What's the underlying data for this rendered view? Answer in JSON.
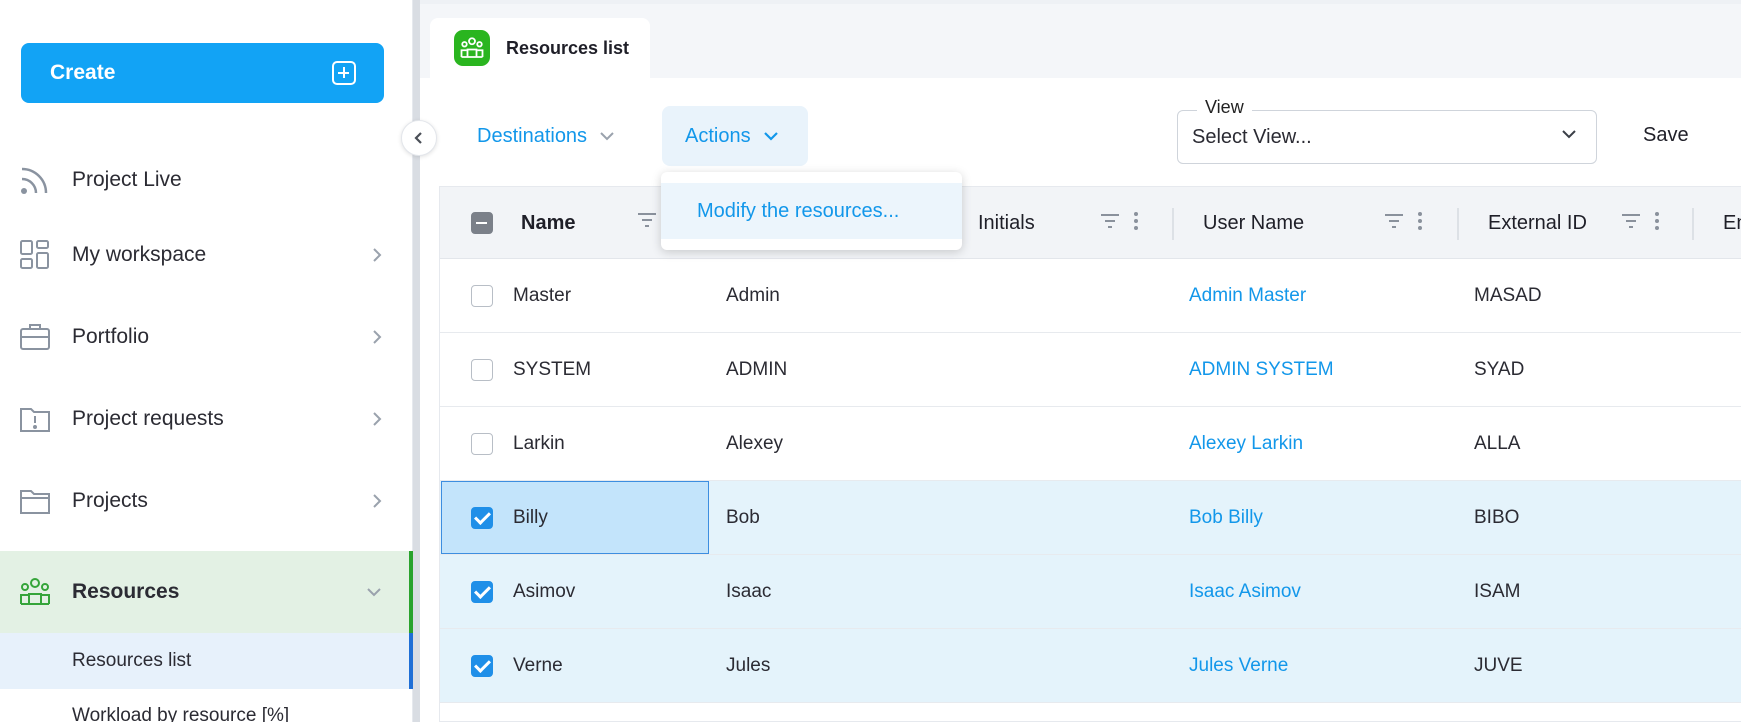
{
  "sidebar": {
    "create_label": "Create",
    "items": [
      {
        "label": "Project Live"
      },
      {
        "label": "My workspace"
      },
      {
        "label": "Portfolio"
      },
      {
        "label": "Project requests"
      },
      {
        "label": "Projects"
      },
      {
        "label": "Resources"
      }
    ],
    "sub_items": [
      {
        "label": "Resources list"
      },
      {
        "label": "Workload by resource [%]"
      }
    ]
  },
  "tab": {
    "label": "Resources list"
  },
  "toolbar": {
    "destinations_label": "Destinations",
    "actions_label": "Actions",
    "view_legend": "View",
    "view_value": "Select View...",
    "save_label": "Save"
  },
  "actions_menu": {
    "items": [
      {
        "label": "Modify the resources..."
      }
    ]
  },
  "table": {
    "headers": [
      "Name",
      "Initials",
      "User Name",
      "External ID",
      "En"
    ],
    "rows": [
      {
        "name": "Master",
        "first": "Admin",
        "user": "Admin Master",
        "ext": "MASAD",
        "checked": false
      },
      {
        "name": "SYSTEM",
        "first": "ADMIN",
        "user": "ADMIN SYSTEM",
        "ext": "SYAD",
        "checked": false
      },
      {
        "name": "Larkin",
        "first": "Alexey",
        "user": "Alexey Larkin",
        "ext": "ALLA",
        "checked": false
      },
      {
        "name": "Billy",
        "first": "Bob",
        "user": "Bob Billy",
        "ext": "BIBO",
        "checked": true
      },
      {
        "name": "Asimov",
        "first": "Isaac",
        "user": "Isaac Asimov",
        "ext": "ISAM",
        "checked": true
      },
      {
        "name": "Verne",
        "first": "Jules",
        "user": "Jules Verne",
        "ext": "JUVE",
        "checked": true
      }
    ]
  },
  "colors": {
    "accent": "#12a3f5",
    "link": "#1297ea",
    "active_nav": "#e3f1e4",
    "selected_row": "#e4f3fb"
  }
}
